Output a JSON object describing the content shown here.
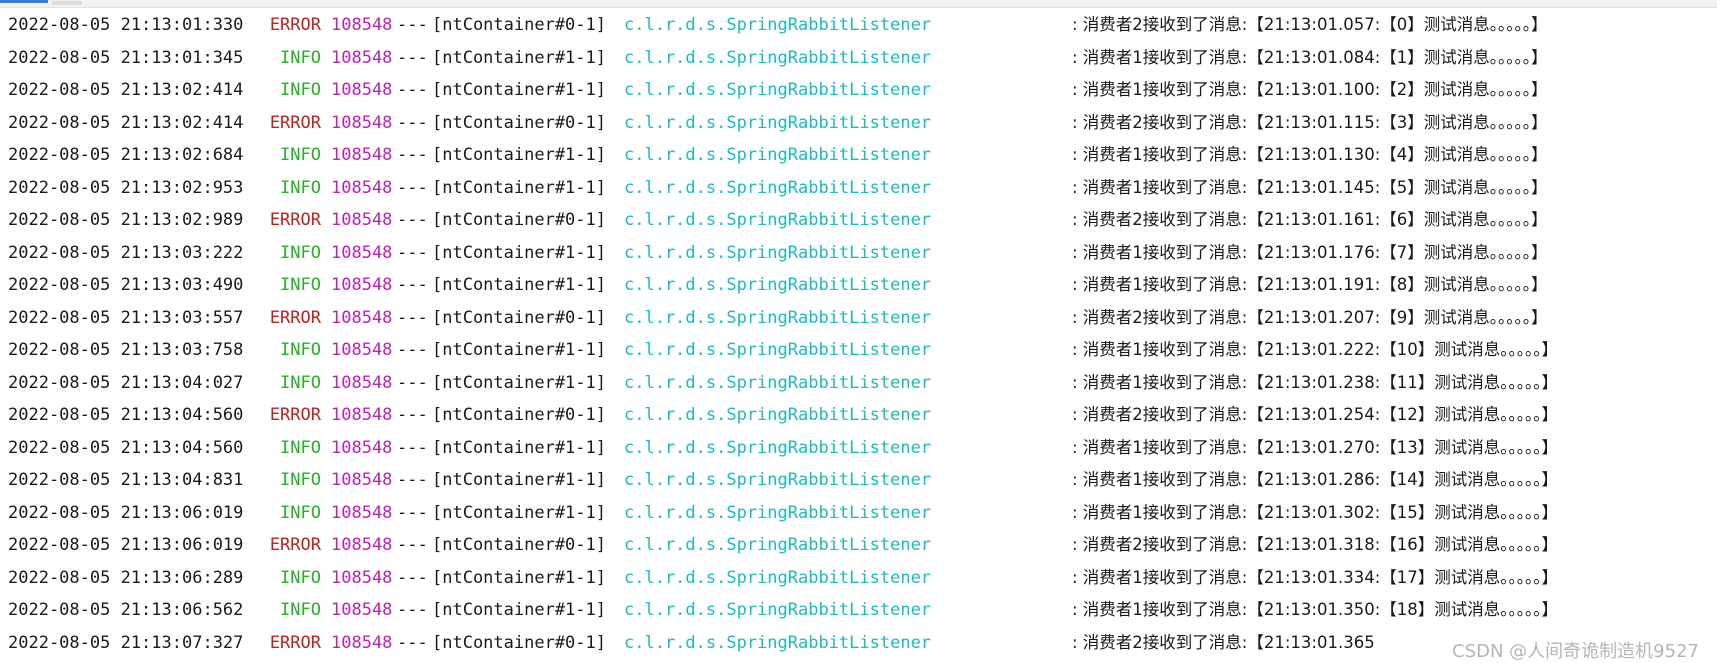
{
  "console": {
    "lines": [
      {
        "timestamp": "2022-08-05 21:13:01:330",
        "level": "ERROR",
        "pid": "108548",
        "sep": "---",
        "thread": "[ntContainer#0-1]",
        "logger": "c.l.r.d.s.SpringRabbitListener",
        "message": ": 消费者2接收到了消息:【21:13:01.057:【0】测试消息。。。。。】"
      },
      {
        "timestamp": "2022-08-05 21:13:01:345",
        "level": "INFO",
        "pid": "108548",
        "sep": "---",
        "thread": "[ntContainer#1-1]",
        "logger": "c.l.r.d.s.SpringRabbitListener",
        "message": ": 消费者1接收到了消息:【21:13:01.084:【1】测试消息。。。。。】"
      },
      {
        "timestamp": "2022-08-05 21:13:02:414",
        "level": "INFO",
        "pid": "108548",
        "sep": "---",
        "thread": "[ntContainer#1-1]",
        "logger": "c.l.r.d.s.SpringRabbitListener",
        "message": ": 消费者1接收到了消息:【21:13:01.100:【2】测试消息。。。。。】"
      },
      {
        "timestamp": "2022-08-05 21:13:02:414",
        "level": "ERROR",
        "pid": "108548",
        "sep": "---",
        "thread": "[ntContainer#0-1]",
        "logger": "c.l.r.d.s.SpringRabbitListener",
        "message": ": 消费者2接收到了消息:【21:13:01.115:【3】测试消息。。。。。】"
      },
      {
        "timestamp": "2022-08-05 21:13:02:684",
        "level": "INFO",
        "pid": "108548",
        "sep": "---",
        "thread": "[ntContainer#1-1]",
        "logger": "c.l.r.d.s.SpringRabbitListener",
        "message": ": 消费者1接收到了消息:【21:13:01.130:【4】测试消息。。。。。】"
      },
      {
        "timestamp": "2022-08-05 21:13:02:953",
        "level": "INFO",
        "pid": "108548",
        "sep": "---",
        "thread": "[ntContainer#1-1]",
        "logger": "c.l.r.d.s.SpringRabbitListener",
        "message": ": 消费者1接收到了消息:【21:13:01.145:【5】测试消息。。。。。】"
      },
      {
        "timestamp": "2022-08-05 21:13:02:989",
        "level": "ERROR",
        "pid": "108548",
        "sep": "---",
        "thread": "[ntContainer#0-1]",
        "logger": "c.l.r.d.s.SpringRabbitListener",
        "message": ": 消费者2接收到了消息:【21:13:01.161:【6】测试消息。。。。。】"
      },
      {
        "timestamp": "2022-08-05 21:13:03:222",
        "level": "INFO",
        "pid": "108548",
        "sep": "---",
        "thread": "[ntContainer#1-1]",
        "logger": "c.l.r.d.s.SpringRabbitListener",
        "message": ": 消费者1接收到了消息:【21:13:01.176:【7】测试消息。。。。。】"
      },
      {
        "timestamp": "2022-08-05 21:13:03:490",
        "level": "INFO",
        "pid": "108548",
        "sep": "---",
        "thread": "[ntContainer#1-1]",
        "logger": "c.l.r.d.s.SpringRabbitListener",
        "message": ": 消费者1接收到了消息:【21:13:01.191:【8】测试消息。。。。。】"
      },
      {
        "timestamp": "2022-08-05 21:13:03:557",
        "level": "ERROR",
        "pid": "108548",
        "sep": "---",
        "thread": "[ntContainer#0-1]",
        "logger": "c.l.r.d.s.SpringRabbitListener",
        "message": ": 消费者2接收到了消息:【21:13:01.207:【9】测试消息。。。。。】"
      },
      {
        "timestamp": "2022-08-05 21:13:03:758",
        "level": "INFO",
        "pid": "108548",
        "sep": "---",
        "thread": "[ntContainer#1-1]",
        "logger": "c.l.r.d.s.SpringRabbitListener",
        "message": ": 消费者1接收到了消息:【21:13:01.222:【10】测试消息。。。。。】"
      },
      {
        "timestamp": "2022-08-05 21:13:04:027",
        "level": "INFO",
        "pid": "108548",
        "sep": "---",
        "thread": "[ntContainer#1-1]",
        "logger": "c.l.r.d.s.SpringRabbitListener",
        "message": ": 消费者1接收到了消息:【21:13:01.238:【11】测试消息。。。。。】"
      },
      {
        "timestamp": "2022-08-05 21:13:04:560",
        "level": "ERROR",
        "pid": "108548",
        "sep": "---",
        "thread": "[ntContainer#0-1]",
        "logger": "c.l.r.d.s.SpringRabbitListener",
        "message": ": 消费者2接收到了消息:【21:13:01.254:【12】测试消息。。。。。】"
      },
      {
        "timestamp": "2022-08-05 21:13:04:560",
        "level": "INFO",
        "pid": "108548",
        "sep": "---",
        "thread": "[ntContainer#1-1]",
        "logger": "c.l.r.d.s.SpringRabbitListener",
        "message": ": 消费者1接收到了消息:【21:13:01.270:【13】测试消息。。。。。】"
      },
      {
        "timestamp": "2022-08-05 21:13:04:831",
        "level": "INFO",
        "pid": "108548",
        "sep": "---",
        "thread": "[ntContainer#1-1]",
        "logger": "c.l.r.d.s.SpringRabbitListener",
        "message": ": 消费者1接收到了消息:【21:13:01.286:【14】测试消息。。。。。】"
      },
      {
        "timestamp": "2022-08-05 21:13:06:019",
        "level": "INFO",
        "pid": "108548",
        "sep": "---",
        "thread": "[ntContainer#1-1]",
        "logger": "c.l.r.d.s.SpringRabbitListener",
        "message": ": 消费者1接收到了消息:【21:13:01.302:【15】测试消息。。。。。】"
      },
      {
        "timestamp": "2022-08-05 21:13:06:019",
        "level": "ERROR",
        "pid": "108548",
        "sep": "---",
        "thread": "[ntContainer#0-1]",
        "logger": "c.l.r.d.s.SpringRabbitListener",
        "message": ": 消费者2接收到了消息:【21:13:01.318:【16】测试消息。。。。。】"
      },
      {
        "timestamp": "2022-08-05 21:13:06:289",
        "level": "INFO",
        "pid": "108548",
        "sep": "---",
        "thread": "[ntContainer#1-1]",
        "logger": "c.l.r.d.s.SpringRabbitListener",
        "message": ": 消费者1接收到了消息:【21:13:01.334:【17】测试消息。。。。。】"
      },
      {
        "timestamp": "2022-08-05 21:13:06:562",
        "level": "INFO",
        "pid": "108548",
        "sep": "---",
        "thread": "[ntContainer#1-1]",
        "logger": "c.l.r.d.s.SpringRabbitListener",
        "message": ": 消费者1接收到了消息:【21:13:01.350:【18】测试消息。。。。。】"
      },
      {
        "timestamp": "2022-08-05 21:13:07:327",
        "level": "ERROR",
        "pid": "108548",
        "sep": "---",
        "thread": "[ntContainer#0-1]",
        "logger": "c.l.r.d.s.SpringRabbitListener",
        "message": ": 消费者2接收到了消息:【21:13:01.365"
      }
    ]
  },
  "watermark": "CSDN @人间奇诡制造机9527",
  "colors": {
    "error": "#c0201c",
    "info": "#22b322",
    "pid": "#c21fb3",
    "logger": "#18bdbd",
    "text": "#1a1a1a",
    "background": "#ffffff"
  }
}
